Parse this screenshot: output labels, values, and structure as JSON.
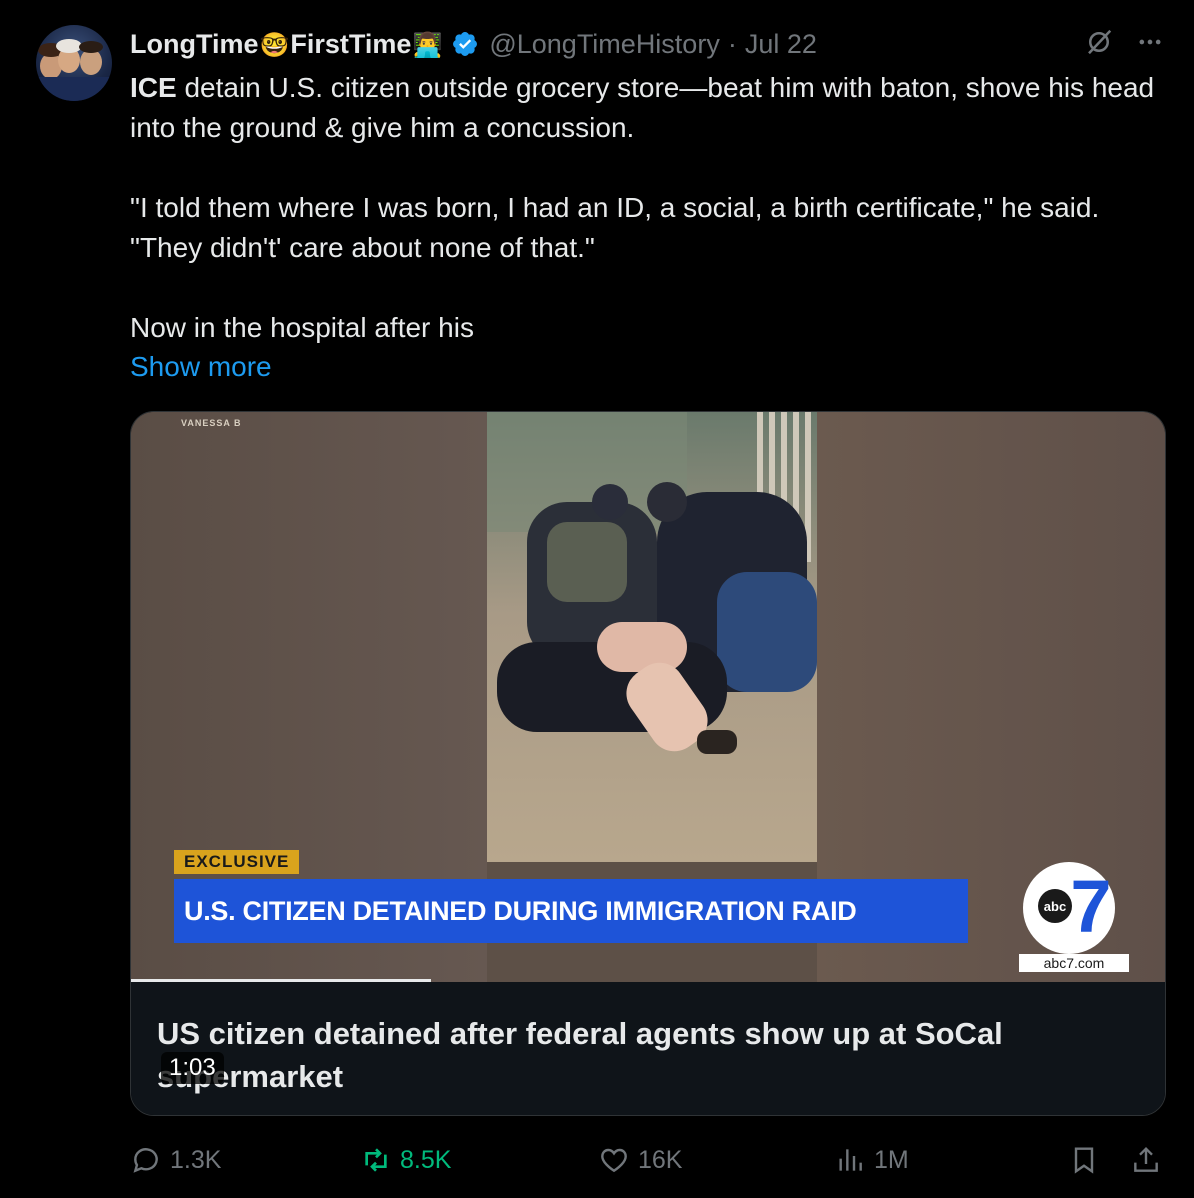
{
  "post": {
    "author_name_part1": "LongTime",
    "author_emoji1": "🤓",
    "author_name_part2": "FirstTime",
    "author_emoji2": "👨‍💻",
    "handle": "@LongTimeHistory",
    "date_sep": "·",
    "date": "Jul 22",
    "text_bold": "ICE",
    "text_line1_rest": " detain U.S. citizen outside grocery store—beat him with baton, shove his head into the ground & give him a concussion.",
    "text_para2": "\"I told them where I was born, I had an ID, a social, a birth certificate,\" he said. \"They didn't' care about none of that.\"",
    "text_para3": "Now in the hospital after his",
    "show_more": "Show more"
  },
  "media": {
    "top_tag": "VANESSA B",
    "exclusive_label": "EXCLUSIVE",
    "headline": "U.S. CITIZEN DETAINED DURING IMMIGRATION RAID",
    "station_url": "abc7.com",
    "station_logo_text": "abc",
    "station_number": "7",
    "caption": "US citizen detained after federal agents show up at SoCal supermarket",
    "duration": "1:03",
    "progress_fraction": 0.29
  },
  "actions": {
    "replies": "1.3K",
    "reposts": "8.5K",
    "likes": "16K",
    "views": "1M"
  },
  "icons": {
    "verified": "verified-badge-icon",
    "grok": "grok-icon",
    "more": "more-icon",
    "reply": "reply-icon",
    "repost": "repost-icon",
    "like": "like-icon",
    "views": "views-icon",
    "bookmark": "bookmark-icon",
    "share": "share-icon"
  },
  "colors": {
    "background": "#000000",
    "text": "#e7e9ea",
    "muted": "#71767b",
    "link": "#1d9bf0",
    "verified": "#1d9bf0",
    "repost_active": "#00ba7c",
    "headline_bar": "#1e54d8",
    "exclusive_tag": "#d9a31d"
  }
}
